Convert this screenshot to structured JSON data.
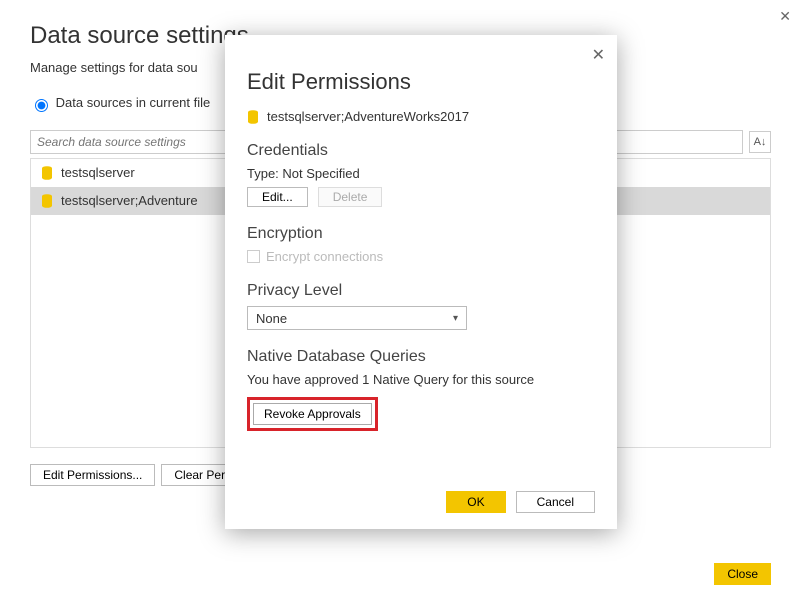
{
  "outer": {
    "title": "Data source settings",
    "subtitle": "Manage settings for data sou",
    "scope_label": "Data sources in current file",
    "search_placeholder": "Search data source settings",
    "sort_glyph": "A↓",
    "items": [
      {
        "label": "testsqlserver"
      },
      {
        "label": "testsqlserver;Adventure"
      }
    ],
    "edit_perm_label": "Edit Permissions...",
    "clear_perm_label": "Clear Perm",
    "close_label": "Close"
  },
  "dialog": {
    "title": "Edit Permissions",
    "ds_name": "testsqlserver;AdventureWorks2017",
    "credentials": {
      "heading": "Credentials",
      "type_line": "Type: Not Specified",
      "edit": "Edit...",
      "delete": "Delete"
    },
    "encryption": {
      "heading": "Encryption",
      "checkbox_label": "Encrypt connections"
    },
    "privacy": {
      "heading": "Privacy Level",
      "value": "None"
    },
    "native": {
      "heading": "Native Database Queries",
      "message": "You have approved 1 Native Query for this source",
      "revoke": "Revoke Approvals"
    },
    "ok": "OK",
    "cancel": "Cancel"
  }
}
